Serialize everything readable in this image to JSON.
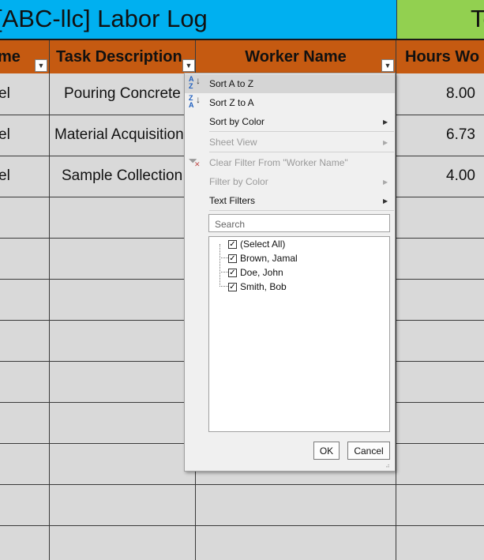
{
  "title": "[ABC-llc] Labor Log",
  "total_label": "To",
  "headers": {
    "col_a": "me",
    "task": "Task Description",
    "worker": "Worker Name",
    "hours": "Hours Wo"
  },
  "rows": [
    {
      "col_a": "el",
      "task": "Pouring Concrete",
      "hours": "8.00"
    },
    {
      "col_a": "el",
      "task": "Material Acquisition",
      "hours": "6.73"
    },
    {
      "col_a": "el",
      "task": "Sample Collection",
      "hours": "4.00"
    }
  ],
  "filter_menu": {
    "sort_az": "Sort A to Z",
    "sort_za": "Sort Z to A",
    "sort_color": "Sort by Color",
    "sheet_view": "Sheet View",
    "clear_filter": "Clear Filter From \"Worker Name\"",
    "filter_color": "Filter by Color",
    "text_filters": "Text Filters",
    "search_placeholder": "Search",
    "items": [
      "(Select All)",
      "Brown, Jamal",
      "Doe, John",
      "Smith, Bob"
    ],
    "ok": "OK",
    "cancel": "Cancel"
  }
}
